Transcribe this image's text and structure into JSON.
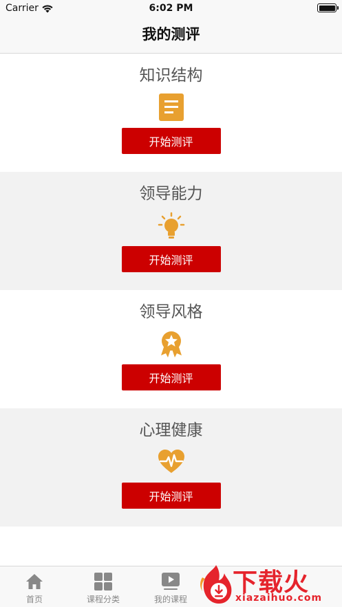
{
  "status_bar": {
    "carrier": "Carrier",
    "time": "6:02 PM"
  },
  "nav": {
    "title": "我的测评"
  },
  "cards": [
    {
      "title": "知识结构",
      "icon": "document-icon",
      "button": "开始测评"
    },
    {
      "title": "领导能力",
      "icon": "lightbulb-icon",
      "button": "开始测评"
    },
    {
      "title": "领导风格",
      "icon": "badge-icon",
      "button": "开始测评"
    },
    {
      "title": "心理健康",
      "icon": "heartbeat-icon",
      "button": "开始测评"
    }
  ],
  "tabs": [
    {
      "label": "首页",
      "icon": "home-icon"
    },
    {
      "label": "课程分类",
      "icon": "grid-icon"
    },
    {
      "label": "我的课程",
      "icon": "play-icon"
    }
  ],
  "watermark": {
    "brand": "下载火",
    "domain": "xiazaihuo.com"
  },
  "colors": {
    "accent": "#cc0000",
    "icon": "#e8a030",
    "alt_row": "#f2f2f2",
    "watermark": "#e5242c"
  }
}
